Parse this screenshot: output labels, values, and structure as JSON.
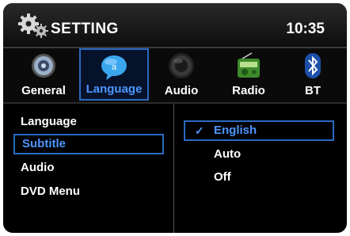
{
  "header": {
    "title": "SETTING",
    "time": "10:35"
  },
  "tabs": [
    {
      "label": "General",
      "icon": "gear-speaker-icon"
    },
    {
      "label": "Language",
      "icon": "chat-bubble-icon",
      "selected": true
    },
    {
      "label": "Audio",
      "icon": "speaker-icon"
    },
    {
      "label": "Radio",
      "icon": "radio-icon"
    },
    {
      "label": "BT",
      "icon": "bluetooth-icon"
    }
  ],
  "menu": [
    {
      "label": "Language"
    },
    {
      "label": "Subtitle",
      "selected": true
    },
    {
      "label": "Audio"
    },
    {
      "label": "DVD Menu"
    }
  ],
  "options": [
    {
      "label": "English",
      "selected": true,
      "check": "✓"
    },
    {
      "label": "Auto"
    },
    {
      "label": "Off"
    }
  ],
  "colors": {
    "accent": "#2a6ac2",
    "accent_text": "#4d95ff",
    "background": "#000000"
  }
}
